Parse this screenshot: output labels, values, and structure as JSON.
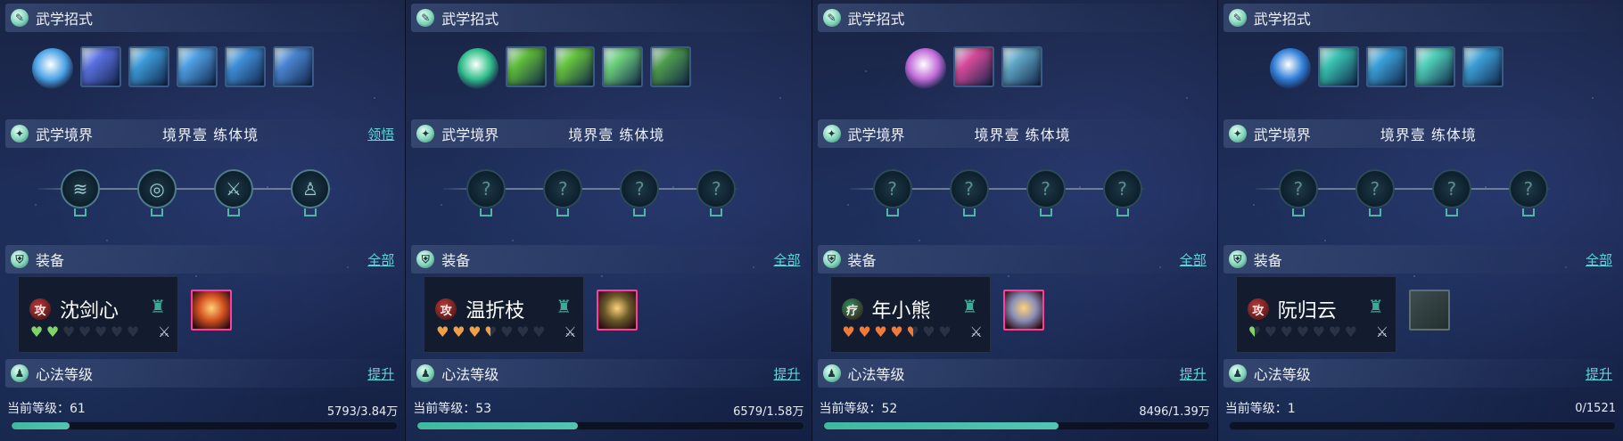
{
  "labels": {
    "skills_title": "武学招式",
    "realm_title": "武学境界",
    "equip_title": "装备",
    "equip_all": "全部",
    "xinfa_title": "心法等级",
    "xinfa_upgrade": "提升",
    "level_prefix": "当前等级："
  },
  "panels": [
    {
      "realm_text": "境界壹  练体境",
      "realm_link": "领悟",
      "skills": [
        {
          "icon": "ice-swirl-icon",
          "color": "#4aa3e6"
        },
        {
          "icon": "blue-blade-icon",
          "color": "#5b6fe0"
        },
        {
          "icon": "water-spiral-icon",
          "color": "#3c9ad8"
        },
        {
          "icon": "ice-slash-icon",
          "color": "#4e9fe3"
        },
        {
          "icon": "lightning-warrior-icon",
          "color": "#3f8fd8"
        },
        {
          "icon": "wave-strike-icon",
          "color": "#4a86d2"
        }
      ],
      "realm_nodes": [
        "wind-slash-icon",
        "spiral-icon",
        "sword-icon",
        "figure-icon"
      ],
      "realm_lit": [
        true,
        true,
        true,
        true
      ],
      "character": {
        "badge": "攻",
        "badge_color": "#b83a3a",
        "name": "沈剑心",
        "heart_color": "#7fd36a",
        "hearts_filled": 2,
        "hearts_total": 7
      },
      "equipment": {
        "icon": "red-armor-icon",
        "color": "#d4511f",
        "empty": false
      },
      "level": "61",
      "exp_text": "5793/3.84万",
      "exp_fraction": 0.15
    },
    {
      "realm_text": "境界壹  练体境",
      "realm_link": "",
      "skills": [
        {
          "icon": "green-figure-icon",
          "color": "#2fbf8a"
        },
        {
          "icon": "green-slash-icon",
          "color": "#5fbe3a"
        },
        {
          "icon": "green-claw-icon",
          "color": "#66c43e"
        },
        {
          "icon": "green-ring-icon",
          "color": "#6ccf7a"
        },
        {
          "icon": "yin-yang-icon",
          "color": "#4e9c4c"
        }
      ],
      "realm_nodes": [
        "locked-icon",
        "locked-icon",
        "locked-icon",
        "locked-icon"
      ],
      "realm_lit": [
        false,
        false,
        false,
        false
      ],
      "character": {
        "badge": "攻",
        "badge_color": "#b83a3a",
        "name": "温折枝",
        "heart_color": "#f0a043",
        "hearts_filled": 3.5,
        "hearts_total": 7
      },
      "equipment": {
        "icon": "dark-armor-icon",
        "color": "#6a5a2a",
        "empty": false
      },
      "level": "53",
      "exp_text": "6579/1.58万",
      "exp_fraction": 0.415
    },
    {
      "realm_text": "境界壹  练体境",
      "realm_link": "",
      "skills": [
        {
          "icon": "purple-crystal-icon",
          "color": "#c06ad8"
        },
        {
          "icon": "pink-beast-icon",
          "color": "#d84a9a"
        },
        {
          "icon": "shell-fan-icon",
          "color": "#5fa6c4"
        }
      ],
      "realm_nodes": [
        "locked-icon",
        "locked-icon",
        "locked-icon",
        "locked-icon"
      ],
      "realm_lit": [
        false,
        false,
        false,
        false
      ],
      "character": {
        "badge": "疗",
        "badge_color": "#2e8f5e",
        "name": "年小熊",
        "heart_color": "#f07a3a",
        "hearts_filled": 4.5,
        "hearts_total": 7
      },
      "equipment": {
        "icon": "silver-armor-icon",
        "color": "#8a8fb8",
        "empty": false
      },
      "level": "52",
      "exp_text": "8496/1.39万",
      "exp_fraction": 0.61
    },
    {
      "realm_text": "境界壹  练体境",
      "realm_link": "",
      "skills": [
        {
          "icon": "blue-orb-icon",
          "color": "#2f7ed8"
        },
        {
          "icon": "teal-slash-icon",
          "color": "#37c0b0"
        },
        {
          "icon": "vortex-icon",
          "color": "#3aa0d8"
        },
        {
          "icon": "star-burst-icon",
          "color": "#4fcfb8"
        },
        {
          "icon": "wave-icon",
          "color": "#3c9fd6"
        }
      ],
      "realm_nodes": [
        "locked-icon",
        "locked-icon",
        "locked-icon",
        "locked-icon"
      ],
      "realm_lit": [
        false,
        false,
        false,
        false
      ],
      "character": {
        "badge": "攻",
        "badge_color": "#b83a3a",
        "name": "阮归云",
        "heart_color": "#7fd36a",
        "hearts_filled": 0.5,
        "hearts_total": 7
      },
      "equipment": {
        "icon": "empty-slot-icon",
        "color": "#4a5a5a",
        "empty": true
      },
      "level": "1",
      "exp_text": "0/1521",
      "exp_fraction": 0.0
    }
  ]
}
